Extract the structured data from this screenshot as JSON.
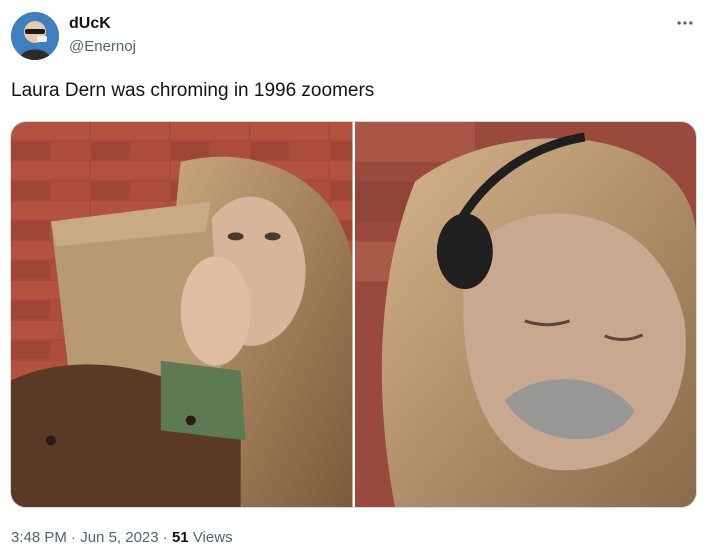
{
  "author": {
    "display_name": "dUcK",
    "handle": "@Enernoj"
  },
  "tweet": {
    "text": "Laura Dern was chroming in 1996 zoomers"
  },
  "media": [
    {
      "label": "photo-1"
    },
    {
      "label": "photo-2"
    }
  ],
  "meta": {
    "time": "3:48 PM",
    "sep1": " · ",
    "date": "Jun 5, 2023",
    "sep2": " · ",
    "views_count": "51",
    "views_label": " Views"
  },
  "icons": {
    "more": "more-horizontal-icon"
  },
  "colors": {
    "text_primary": "#0f1419",
    "text_secondary": "#536471",
    "border": "#cfd9de"
  }
}
